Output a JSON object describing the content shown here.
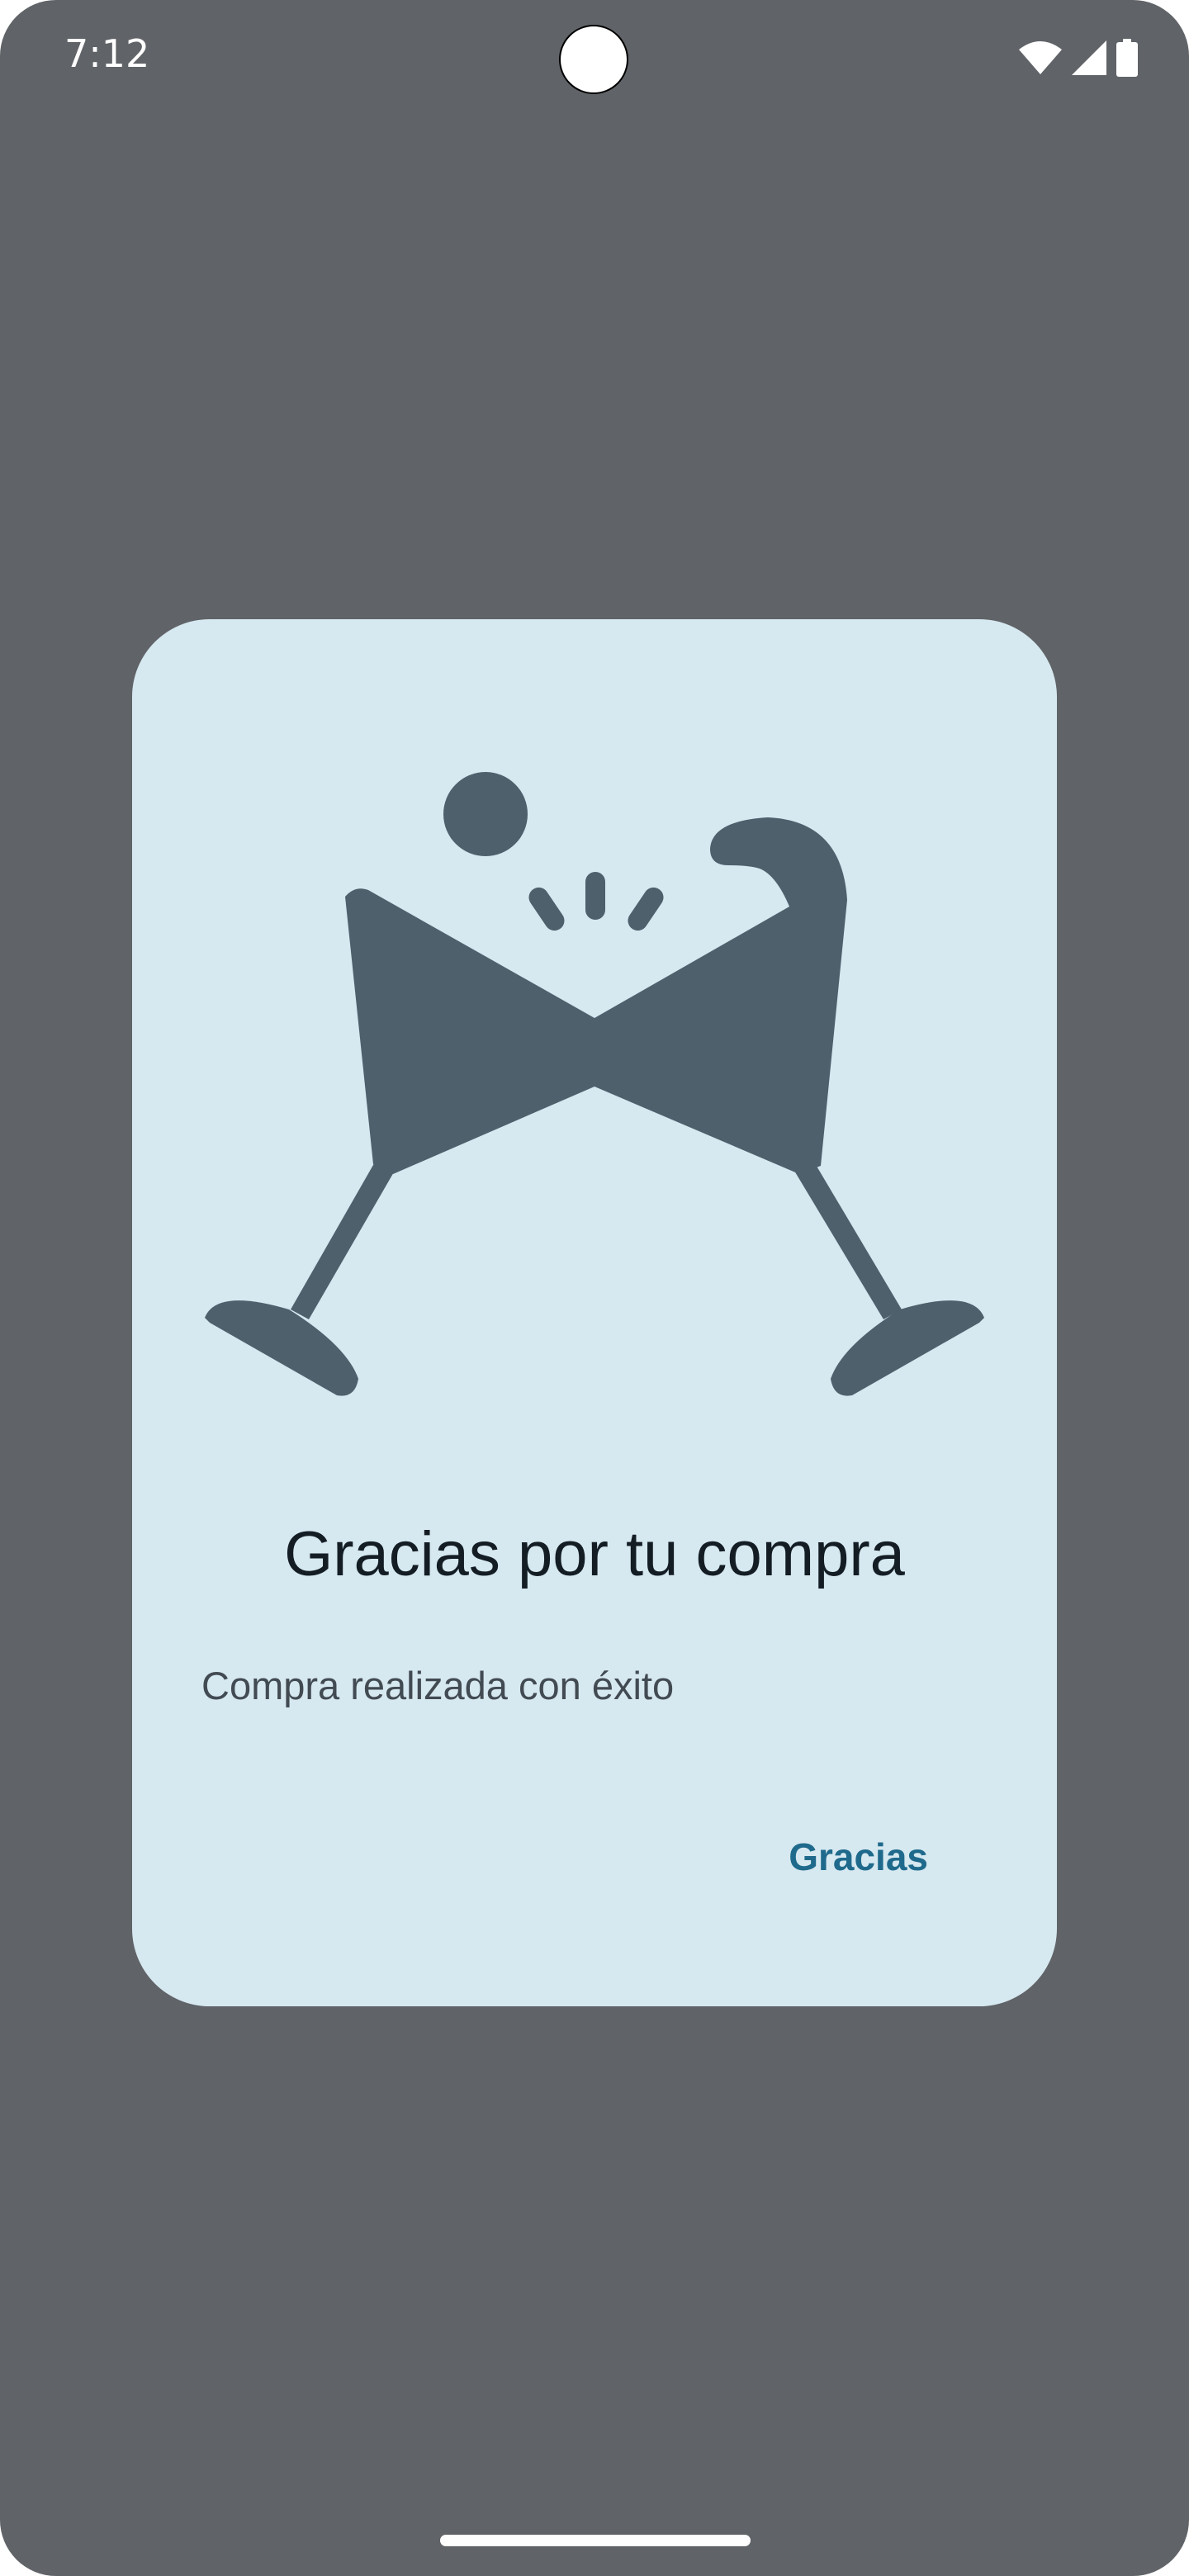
{
  "status_bar": {
    "time": "7:12",
    "icons": [
      "wifi-icon",
      "cell-signal-icon",
      "battery-icon"
    ]
  },
  "dialog": {
    "illustration": "celebration-cocktail-glasses-icon",
    "title": "Gracias por tu compra",
    "message": "Compra realizada con éxito",
    "button_label": "Gracias"
  },
  "colors": {
    "scrim": "#606367",
    "dialog_background": "#d6e8f0",
    "illustration": "#4d606c",
    "title_text": "#141d24",
    "message_text": "#424a52",
    "button_text": "#1f6a8c"
  }
}
